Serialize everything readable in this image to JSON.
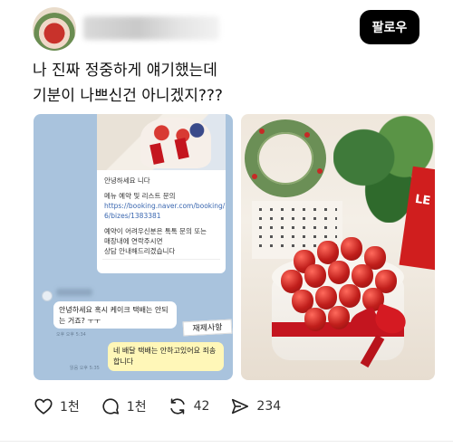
{
  "header": {
    "follow_label": "팔로우"
  },
  "post": {
    "text_line1": "나 진짜 정중하게 얘기했는데",
    "text_line2": "기분이 나쁘신건 아니겠지???"
  },
  "chat_card": {
    "greeting": "안녕하세요        니다",
    "menu_line": "메뉴 예약 및 리스트 문의",
    "link_line1": "https://booking.naver.com/booking/",
    "link_line2": "6/bizes/1383381",
    "notice_line1": "예약이 어려우신분은 톡톡 문의 또는",
    "notice_line2": "매장내에 연락주시면",
    "notice_line3": "상담 안내해드리겠습니다"
  },
  "chat": {
    "incoming_message": "안녕하세요 혹시 케이크 택배는 안되는 거죠? ㅜㅜ",
    "outgoing_message": "네 배달 택배는 안하고있어요 죄송합니다",
    "handwritten_note": "재제사항",
    "time_incoming": "오후 오후 5:34",
    "time_outgoing": "읽음 오후 5:35"
  },
  "photo": {
    "box_text": "LE"
  },
  "actions": {
    "like_count": "1천",
    "comment_count": "1천",
    "repost_count": "42",
    "share_count": "234"
  },
  "icons": {
    "like": "heart-icon",
    "comment": "speech-bubble-icon",
    "repost": "repost-arrows-icon",
    "share": "send-arrow-icon"
  },
  "colors": {
    "follow_button_bg": "#000000",
    "chat_bg": "#a9c3dd",
    "ribbon_red": "#c4151f"
  }
}
